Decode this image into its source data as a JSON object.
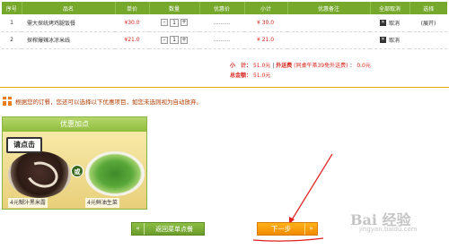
{
  "table": {
    "headers": [
      "序号",
      "品名",
      "单价",
      "数量",
      "优惠价",
      "小计",
      "优惠备注",
      "全部取消",
      "选择"
    ],
    "rows": [
      {
        "index": "1",
        "name": "需大探统烤鸡腿饭餐",
        "price": "¥30.0",
        "qty": "1",
        "discount": "..........",
        "subtotal": "¥ 30.0",
        "cancel": "取消",
        "expand": "(展开)"
      },
      {
        "index": "2",
        "name": "探榨爆辣冰凉米线",
        "price": "¥21.0",
        "qty": "1",
        "discount": "..........",
        "subtotal": "¥ 21.0",
        "cancel": "取消"
      }
    ],
    "minus": "-",
    "plus": "+"
  },
  "totals": {
    "subtotal_label": "小　计：",
    "subtotal_value": "51.0元",
    "delivery_label": "外送费",
    "delivery_note": "(同桌午茶39免外送费)",
    "delivery_value": "0.0元",
    "total_label": "总金额：",
    "total_value": "51.0元"
  },
  "notice": {
    "text": "根据您的订餐，您还可以选择以下优惠项目，如您未选则视为自动放弃。"
  },
  "promo": {
    "header": "优惠加点",
    "click_tag": "请点击",
    "or_label": "或",
    "item1": "4元糊汁黑米露",
    "item2": "4元鲜油生菜"
  },
  "buttons": {
    "back_arrow": "«",
    "back_label": "返回菜单点餐",
    "next_label": "下一步",
    "next_arrow": "»"
  },
  "watermark": {
    "main": "Bai 经验",
    "sub": "jingyan.baidu.com"
  },
  "colors": {
    "header_green": "#76a82c",
    "price_red": "#d9261c",
    "orange_button": "#f08a00",
    "annotation_red": "#e02020"
  }
}
